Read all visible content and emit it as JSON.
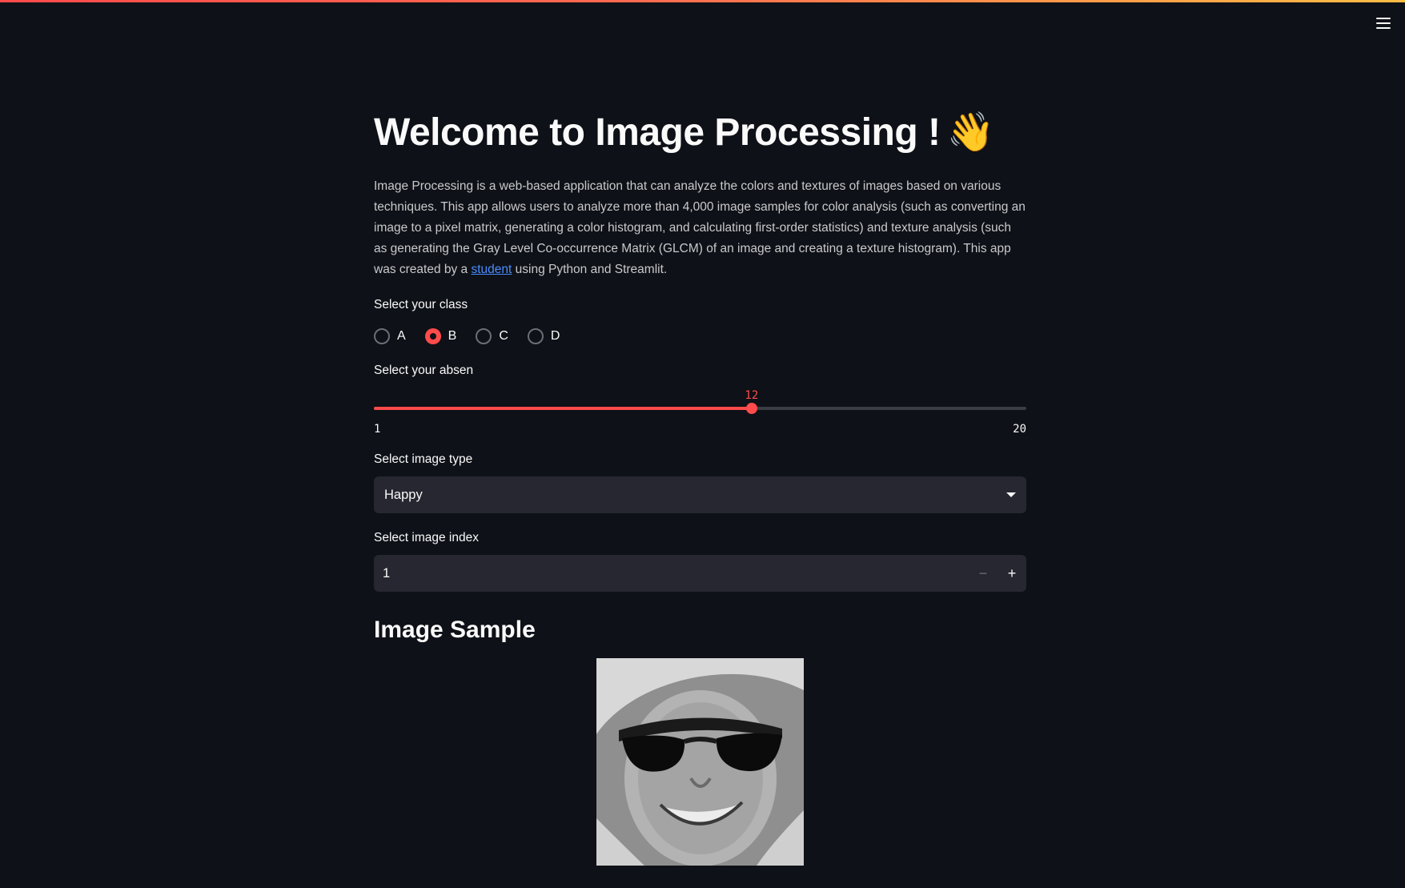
{
  "app": {
    "accent_color": "#ff4b4b",
    "menu_icon": "hamburger-menu-icon"
  },
  "header": {
    "title": "Welcome to Image Processing !",
    "title_emoji": "👋"
  },
  "intro": {
    "text_before_link": "Image Processing is a web-based application that can analyze the colors and textures of images based on various techniques. This app allows users to analyze more than 4,000 image samples for color analysis (such as converting an image to a pixel matrix, generating a color histogram, and calculating first-order statistics) and texture analysis (such as generating the Gray Level Co-occurrence Matrix (GLCM) of an image and creating a texture histogram). This app was created by a ",
    "link_text": "student",
    "text_after_link": " using Python and Streamlit."
  },
  "class_select": {
    "label": "Select your class",
    "options": [
      "A",
      "B",
      "C",
      "D"
    ],
    "selected": "B"
  },
  "absen_slider": {
    "label": "Select your absen",
    "value": 12,
    "min": 1,
    "max": 20,
    "value_text": "12",
    "min_text": "1",
    "max_text": "20"
  },
  "image_type": {
    "label": "Select image type",
    "selected": "Happy"
  },
  "image_index": {
    "label": "Select image index",
    "value": "1",
    "minus_label": "−",
    "plus_label": "+"
  },
  "sample": {
    "heading": "Image Sample"
  }
}
